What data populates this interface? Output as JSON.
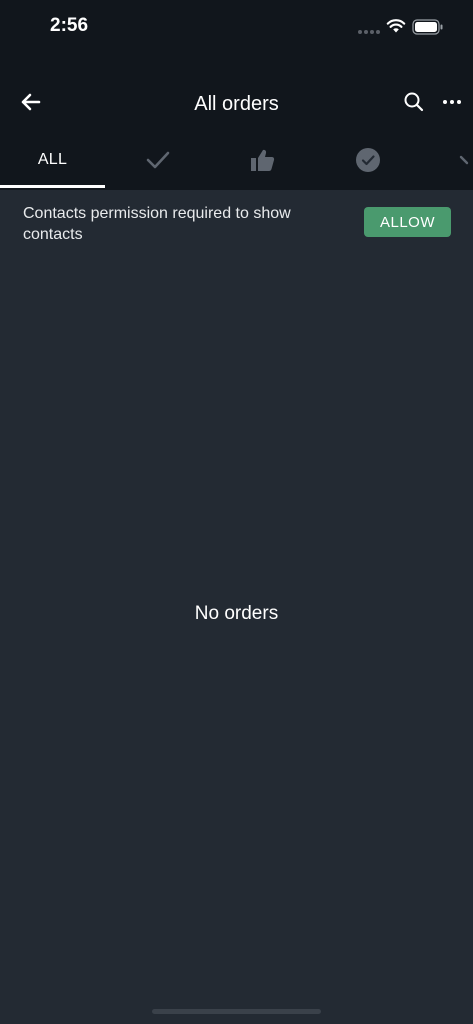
{
  "status_bar": {
    "time": "2:56"
  },
  "header": {
    "title": "All orders"
  },
  "tabs": [
    {
      "label": "ALL",
      "icon": ""
    },
    {
      "label": "",
      "icon": "checkmark-icon"
    },
    {
      "label": "",
      "icon": "thumbs-up-icon"
    },
    {
      "label": "",
      "icon": "check-circle-icon"
    },
    {
      "label": "",
      "icon": "partial-tab-icon"
    }
  ],
  "banner": {
    "text": "Contacts permission required to show contacts",
    "button_label": "ALLOW"
  },
  "empty_state": {
    "text": "No orders"
  },
  "colors": {
    "background": "#232a33",
    "app_bar": "#11161c",
    "accent_green": "#4a9a6e",
    "inactive_icon": "#5f6670"
  }
}
